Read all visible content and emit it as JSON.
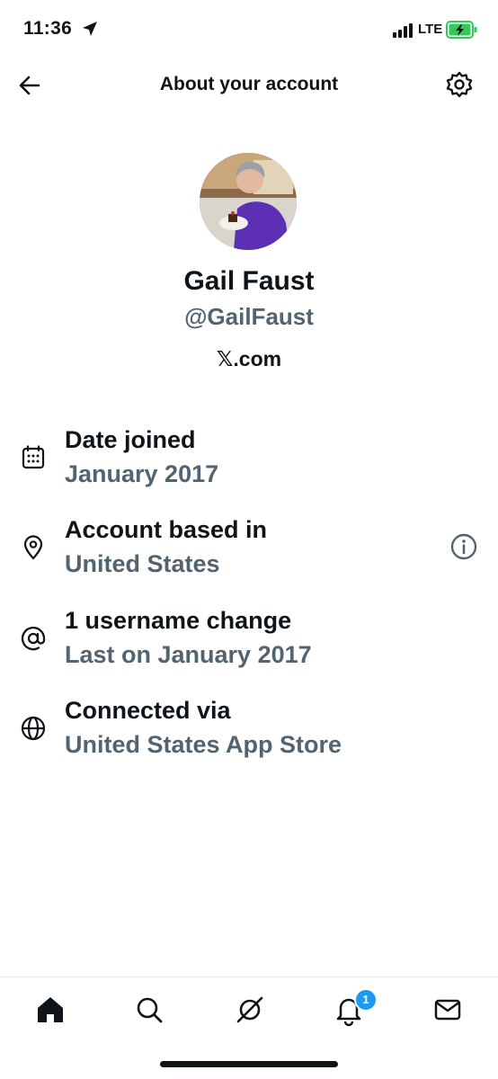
{
  "status_bar": {
    "time": "11:36",
    "network": "LTE",
    "icons": [
      "location-arrow-icon",
      "signal-bars-icon",
      "battery-charging-icon"
    ]
  },
  "header": {
    "title": "About your account",
    "back_icon": "arrow-left-icon",
    "settings_icon": "gear-icon"
  },
  "profile": {
    "name": "Gail Faust",
    "handle": "@GailFaust",
    "site": "𝕏.com"
  },
  "details": [
    {
      "icon": "calendar-icon",
      "title": "Date joined",
      "value": "January 2017"
    },
    {
      "icon": "location-pin-icon",
      "title": "Account based in",
      "value": "United States",
      "has_info": true
    },
    {
      "icon": "at-sign-icon",
      "title": "1 username change",
      "value": "Last on January 2017"
    },
    {
      "icon": "globe-icon",
      "title": "Connected via",
      "value": "United States App Store"
    }
  ],
  "tab_bar": {
    "tabs": [
      "home-icon",
      "search-icon",
      "grok-icon",
      "notifications-icon",
      "messages-icon"
    ],
    "notification_count": "1"
  },
  "colors": {
    "text_primary": "#0f1419",
    "text_secondary": "#536471",
    "accent": "#1d9bf0",
    "battery_charging": "#34c759"
  }
}
